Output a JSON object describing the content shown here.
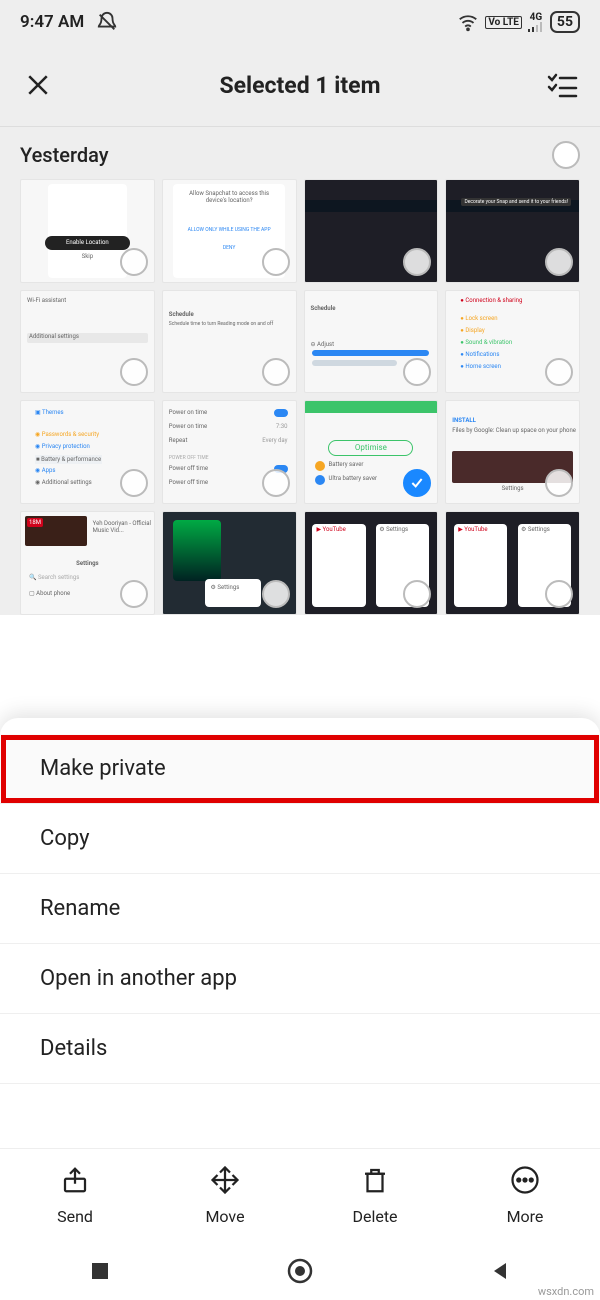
{
  "status": {
    "time": "9:47 AM",
    "dnd_icon": "bell-slash",
    "wifi_icon": "wifi",
    "volte_label": "Vo LTE",
    "network_label": "4G",
    "battery_percent": "55"
  },
  "header": {
    "title": "Selected 1 item"
  },
  "section": {
    "label": "Yesterday"
  },
  "thumbnails": [
    {
      "id": "t1",
      "kind": "snapmap",
      "selected": false
    },
    {
      "id": "t2",
      "kind": "snapchat-perm",
      "selected": false
    },
    {
      "id": "t3",
      "kind": "desktop-dark",
      "selected": false
    },
    {
      "id": "t4",
      "kind": "desktop-dark2",
      "selected": false
    },
    {
      "id": "t5",
      "kind": "wifi-settings",
      "selected": false
    },
    {
      "id": "t6",
      "kind": "schedule",
      "selected": false
    },
    {
      "id": "t7",
      "kind": "schedule-adjust",
      "selected": false
    },
    {
      "id": "t8",
      "kind": "settings-icons",
      "selected": false
    },
    {
      "id": "t9",
      "kind": "themes",
      "selected": false
    },
    {
      "id": "t10",
      "kind": "power-on",
      "selected": false
    },
    {
      "id": "t11",
      "kind": "optimise",
      "selected": true
    },
    {
      "id": "t12",
      "kind": "files-google",
      "selected": false
    },
    {
      "id": "t13",
      "kind": "youtube-music",
      "selected": false
    },
    {
      "id": "t14",
      "kind": "recents-dark",
      "selected": false
    },
    {
      "id": "t15",
      "kind": "recents-white",
      "selected": false
    },
    {
      "id": "t16",
      "kind": "recents-white",
      "selected": false
    }
  ],
  "menu": {
    "items": [
      {
        "label": "Make private",
        "highlight": true
      },
      {
        "label": "Copy",
        "highlight": false
      },
      {
        "label": "Rename",
        "highlight": false
      },
      {
        "label": "Open in another app",
        "highlight": false
      },
      {
        "label": "Details",
        "highlight": false
      }
    ]
  },
  "actions": {
    "send": "Send",
    "move": "Move",
    "delete": "Delete",
    "more": "More"
  },
  "watermark": "wsxdn.com"
}
